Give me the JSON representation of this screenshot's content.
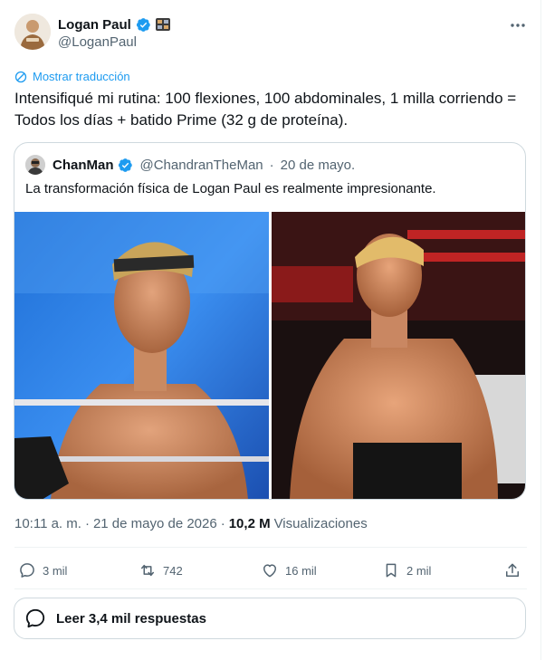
{
  "author": {
    "name": "Logan Paul",
    "handle": "@LoganPaul"
  },
  "translate_label": "Mostrar traducción",
  "tweet": {
    "text": "Intensifiqué mi rutina: 100 flexiones, 100 abdominales, 1 milla corriendo = Todos los días + batido Prime (32 g de proteína)."
  },
  "quote": {
    "name": "ChanMan",
    "handle": "@ChandranTheMan",
    "separator": "·",
    "date": "20 de mayo.",
    "text": "La transformación física de Logan Paul es realmente impresionante."
  },
  "meta": {
    "time": "10:11 a. m.",
    "separator": "·",
    "date": "21 de mayo de 2026",
    "separator2": "·",
    "views_count": "10,2 M",
    "views_label": "Visualizaciones"
  },
  "actions": {
    "replies": "3 mil",
    "reposts": "742",
    "likes": "16 mil",
    "bookmarks": "2 mil"
  },
  "read_replies": "Leer 3,4 mil respuestas",
  "colors": {
    "accent": "#1d9bf0",
    "text": "#0f1419",
    "muted": "#536471",
    "border": "#cfd9de"
  }
}
